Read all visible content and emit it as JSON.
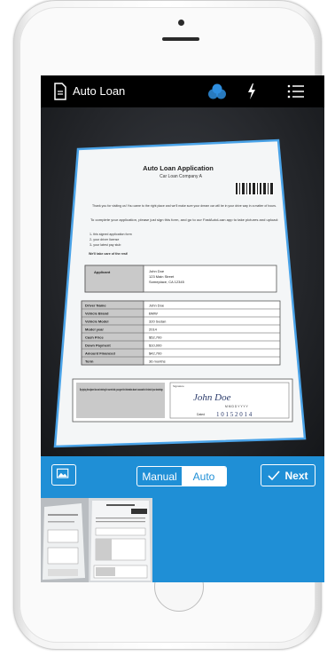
{
  "app": {
    "title": "Auto Loan",
    "icons": {
      "document": "document-icon",
      "auto_mode": "auto-mode-icon",
      "flash": "flash-icon",
      "menu": "menu-icon"
    }
  },
  "controls": {
    "mode_manual": "Manual",
    "mode_auto": "Auto",
    "selected_mode": "Auto",
    "next_label": "Next",
    "photo_icon": "photo-gallery-icon",
    "check_icon": "checkmark-icon"
  },
  "document": {
    "title": "Auto Loan Application",
    "subtitle": "Car Loan Company A",
    "intro_1": "Thank you for visiting us! You came to the right place and we'll make sure your dream car will be in your drive way in a matter of hours.",
    "intro_2": "To complete your application, please just sign this form, and go to our FastAutoLoan app to take pictures and upload:",
    "list_1": "1- this signed application form",
    "list_2": "2- your driver license",
    "list_3": "3- your latest pay stub",
    "closing": "We'll take care of the rest!",
    "applicant_label": "Applicant",
    "applicant_name": "John Doe",
    "applicant_street": "123 Main Street",
    "applicant_city": "Someplace, CA 12345",
    "rows": [
      {
        "label": "Driver Name",
        "value": "John Doe"
      },
      {
        "label": "Vehicle Brand",
        "value": "BMW"
      },
      {
        "label": "Vehicle Model",
        "value": "320 Sedan"
      },
      {
        "label": "Model year",
        "value": "2014"
      },
      {
        "label": "Cash Price",
        "value": "$52,700"
      },
      {
        "label": "Down Payment",
        "value": "$10,000"
      },
      {
        "label": "Amount Financed",
        "value": "$42,700"
      },
      {
        "label": "Term",
        "value": "36 months"
      }
    ],
    "consent": "By signing the adjacent box and entering the current date, you agree the information above is accurate to the best of your knowledge.",
    "signature_label": "Signature",
    "signature": "John Doe",
    "date_format": "M M D D Y Y Y Y",
    "date_label": "Dated",
    "date_value": "1 0 1 5 2 0 1 4"
  },
  "colors": {
    "accent": "#1f8fd6",
    "screen_bg": "#000000",
    "auto_icon": "#2f8fe0"
  }
}
